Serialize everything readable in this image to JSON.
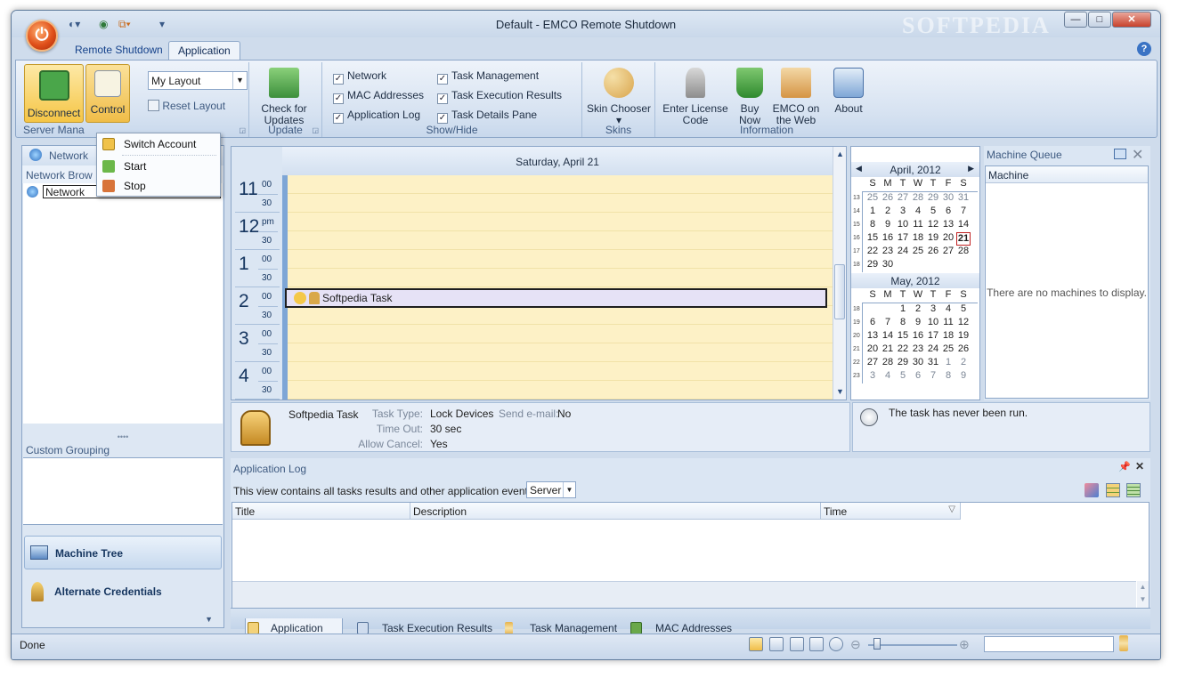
{
  "window": {
    "title": "Default - EMCO Remote Shutdown",
    "watermark": "SOFTPEDIA",
    "buttons": {
      "minimize": "—",
      "maximize": "□",
      "close": "✕"
    }
  },
  "ribbon": {
    "tabs": [
      "Remote Shutdown",
      "Application"
    ],
    "active_tab": "Application",
    "groups": {
      "server_management": {
        "label": "Server Mana",
        "disconnect": "Disconnect",
        "control": "Control"
      },
      "layout": {
        "select_value": "My Layout",
        "reset": "Reset Layout"
      },
      "update": {
        "label": "Update",
        "check": "Check for Updates"
      },
      "show_hide": {
        "label": "Show/Hide",
        "items": [
          {
            "label": "Network",
            "checked": true
          },
          {
            "label": "MAC Addresses",
            "checked": true
          },
          {
            "label": "Application Log",
            "checked": true
          },
          {
            "label": "Task Management",
            "checked": true
          },
          {
            "label": "Task Execution Results",
            "checked": true
          },
          {
            "label": "Task Details Pane",
            "checked": true
          }
        ]
      },
      "skins": {
        "label": "Skins",
        "chooser": "Skin Chooser"
      },
      "information": {
        "label": "Information",
        "enter_license": "Enter License Code",
        "buy_now": "Buy Now",
        "emco_web": "EMCO on the Web",
        "about": "About"
      }
    }
  },
  "control_menu": {
    "items": [
      "Switch Account",
      "Start",
      "Stop"
    ]
  },
  "left_panel": {
    "network_header": "Network",
    "network_browser": "Network Brow",
    "tree_item": "Network",
    "custom_grouping": "Custom Grouping",
    "nav_machine_tree": "Machine Tree",
    "nav_alternate_credentials": "Alternate Credentials"
  },
  "scheduler": {
    "date_header": "Saturday, April 21",
    "hours": [
      {
        "h": "11",
        "m": "00"
      },
      {
        "h": "12",
        "m": "pm"
      },
      {
        "h": "1",
        "m": "00"
      },
      {
        "h": "2",
        "m": "00"
      },
      {
        "h": "3",
        "m": "00"
      },
      {
        "h": "4",
        "m": "00"
      }
    ],
    "half": "30",
    "task_label": "Softpedia Task"
  },
  "calendar": {
    "weekdays": [
      "S",
      "M",
      "T",
      "W",
      "T",
      "F",
      "S"
    ],
    "april": {
      "title": "April, 2012",
      "rows": [
        {
          "wk": "13",
          "days": [
            "25",
            "26",
            "27",
            "28",
            "29",
            "30",
            "31"
          ]
        },
        {
          "wk": "14",
          "days": [
            "1",
            "2",
            "3",
            "4",
            "5",
            "6",
            "7"
          ]
        },
        {
          "wk": "15",
          "days": [
            "8",
            "9",
            "10",
            "11",
            "12",
            "13",
            "14"
          ]
        },
        {
          "wk": "16",
          "days": [
            "15",
            "16",
            "17",
            "18",
            "19",
            "20",
            "21"
          ]
        },
        {
          "wk": "17",
          "days": [
            "22",
            "23",
            "24",
            "25",
            "26",
            "27",
            "28"
          ]
        },
        {
          "wk": "18",
          "days": [
            "29",
            "30",
            "",
            "",
            "",
            "",
            ""
          ]
        }
      ]
    },
    "may": {
      "title": "May, 2012",
      "rows": [
        {
          "wk": "18",
          "days": [
            "",
            "",
            "1",
            "2",
            "3",
            "4",
            "5"
          ]
        },
        {
          "wk": "19",
          "days": [
            "6",
            "7",
            "8",
            "9",
            "10",
            "11",
            "12"
          ]
        },
        {
          "wk": "20",
          "days": [
            "13",
            "14",
            "15",
            "16",
            "17",
            "18",
            "19"
          ]
        },
        {
          "wk": "21",
          "days": [
            "20",
            "21",
            "22",
            "23",
            "24",
            "25",
            "26"
          ]
        },
        {
          "wk": "22",
          "days": [
            "27",
            "28",
            "29",
            "30",
            "31",
            "1",
            "2"
          ]
        },
        {
          "wk": "23",
          "days": [
            "3",
            "4",
            "5",
            "6",
            "7",
            "8",
            "9"
          ]
        }
      ]
    },
    "today": "21"
  },
  "machine_queue": {
    "title": "Machine Queue",
    "column": "Machine",
    "empty": "There are no machines to display."
  },
  "task_details": {
    "name": "Softpedia Task",
    "task_type_label": "Task Type:",
    "task_type": "Lock Devices",
    "timeout_label": "Time Out:",
    "timeout": "30 sec",
    "allow_cancel_label": "Allow Cancel:",
    "allow_cancel": "Yes",
    "email_label": "Send e-mail:",
    "email": "No",
    "run_status": "The task has never been run."
  },
  "app_log": {
    "title": "Application Log",
    "filter_text": "This view contains all tasks results and other application events for:",
    "filter_value": "Server",
    "columns": [
      "Title",
      "Description",
      "Time"
    ]
  },
  "bottom_tabs": [
    "Application Log",
    "Task Execution Results",
    "Task Management",
    "MAC Addresses"
  ],
  "status": {
    "text": "Done"
  }
}
